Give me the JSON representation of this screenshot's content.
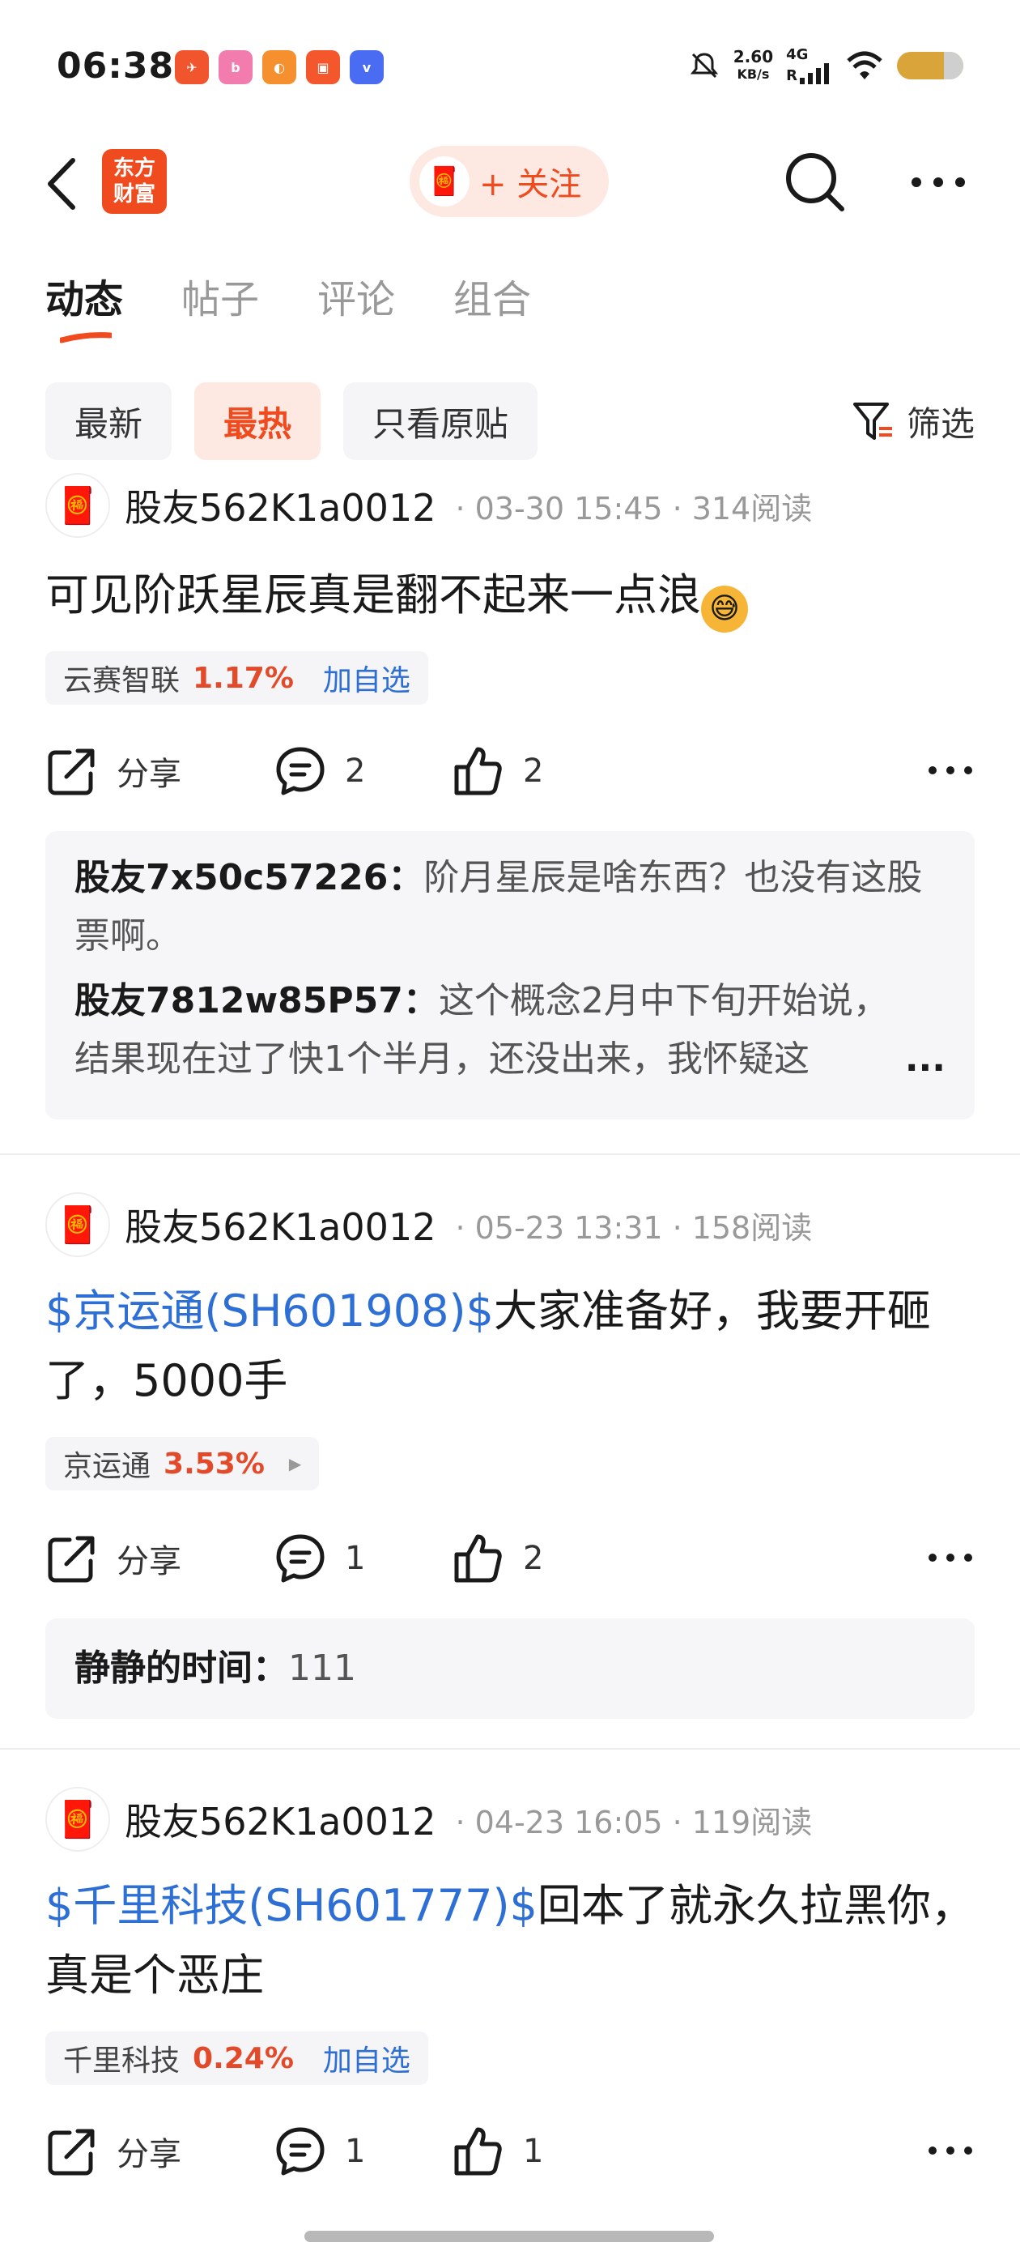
{
  "status_bar": {
    "time": "06:38",
    "net_speed_value": "2.60",
    "net_speed_unit": "KB/s",
    "net_type": "4G",
    "net_r": "R"
  },
  "nav": {
    "logo_line1": "东方",
    "logo_line2": "财富",
    "follow_label": "+ 关注"
  },
  "tabs": [
    "动态",
    "帖子",
    "评论",
    "组合"
  ],
  "filters": [
    "最新",
    "最热",
    "只看原贴"
  ],
  "filter_button_label": "筛选",
  "accent_color": "#ef4b1f",
  "link_color": "#2e6fd6",
  "posts": [
    {
      "author": "股友562K1a0012",
      "date": "03-30 15:45",
      "reads": "314阅读",
      "text": "可见阶跃星辰真是翻不起来一点浪",
      "stock_name": "云赛智联",
      "stock_pct": "1.17%",
      "stock_action": "加自选",
      "share_label": "分享",
      "comment_count": "2",
      "like_count": "2",
      "comments": [
        {
          "author": "股友7x50c57226：",
          "text": "阶月星辰是啥东西？也没有这股票啊。"
        },
        {
          "author": "股友7812w85P57：",
          "text": "这个概念2月中下旬开始说，结果现在过了快1个半月，还没出来，我怀疑这",
          "more": "..."
        }
      ]
    },
    {
      "author": "股友562K1a0012",
      "date": "05-23 13:31",
      "reads": "158阅读",
      "stock_link": "$京运通(SH601908)$",
      "text": "大家准备好，我要开砸了，5000手",
      "stock_name": "京运通",
      "stock_pct": "3.53%",
      "share_label": "分享",
      "comment_count": "1",
      "like_count": "2",
      "comments": [
        {
          "author": "静静的时间：",
          "text": "111"
        }
      ]
    },
    {
      "author": "股友562K1a0012",
      "date": "04-23 16:05",
      "reads": "119阅读",
      "stock_link": "$千里科技(SH601777)$",
      "text": "回本了就永久拉黑你，真是个恶庄",
      "stock_name": "千里科技",
      "stock_pct": "0.24%",
      "stock_action": "加自选",
      "share_label": "分享",
      "comment_count": "1",
      "like_count": "1"
    }
  ]
}
